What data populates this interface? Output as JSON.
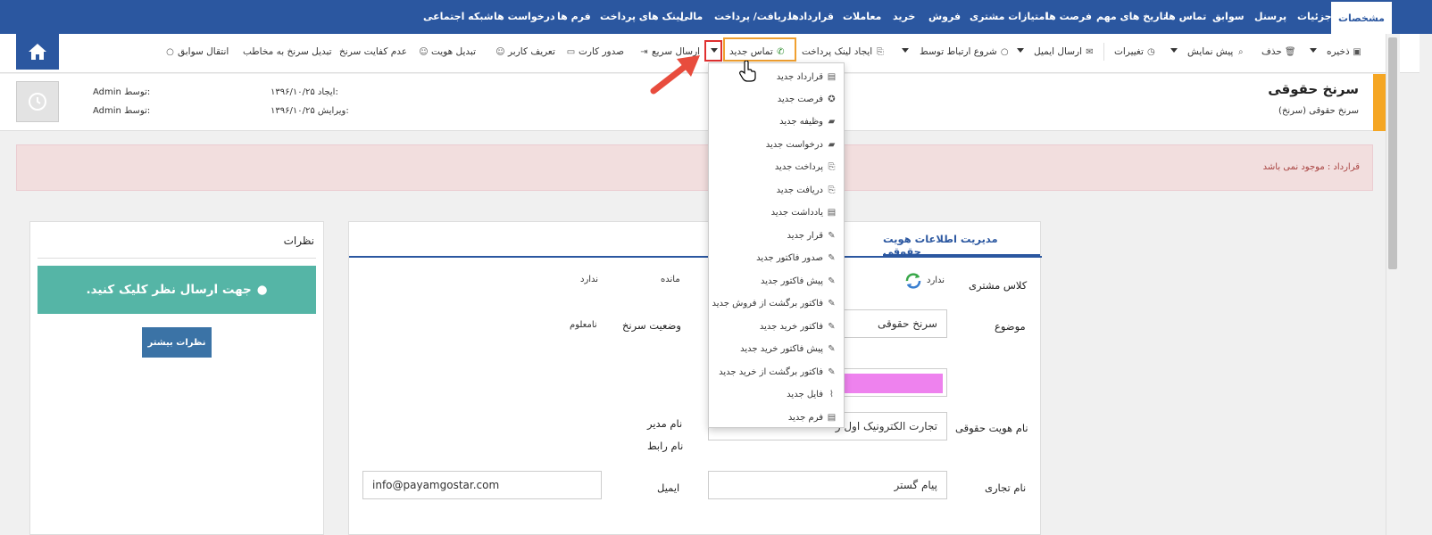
{
  "topnav": {
    "tabs": [
      {
        "label": "مشخصات",
        "active": true
      },
      {
        "label": "جزئیات"
      },
      {
        "label": "پرسنل"
      },
      {
        "label": "سوابق"
      },
      {
        "label": "تماس ها"
      },
      {
        "label": "تاریخ های مهم"
      },
      {
        "label": "فرصت ها"
      },
      {
        "label": "امتیازات مشتری"
      },
      {
        "label": "فروش"
      },
      {
        "label": "خرید"
      },
      {
        "label": "معاملات"
      },
      {
        "label": "قراردادها"
      },
      {
        "label": "دریافت/ پرداخت"
      },
      {
        "label": "مالی"
      },
      {
        "label": "لینک های پرداخت"
      },
      {
        "label": "فرم ها"
      },
      {
        "label": "درخواست ها"
      },
      {
        "label": "شبکه اجتماعی"
      }
    ]
  },
  "toolbar": {
    "save": "ذخیره",
    "delete": "حذف",
    "preview": "پیش نمایش",
    "changes": "تغییرات",
    "send_email": "ارسال ایمیل",
    "start_contact": "شروع ارتباط توسط",
    "create_payment_link": "ایجاد لینک پرداخت",
    "new_call": "تماس جدید",
    "quick_send": "ارسال سریع",
    "issue_card": "صدور کارت",
    "define_user": "تعریف کاربر",
    "change_identity": "تبدیل هویت",
    "lead_disqualify": "عدم کفایت سرنخ",
    "convert_to_contact": "تبدیل سرنخ به مخاطب",
    "transfer_history": "انتقال سوابق"
  },
  "record": {
    "title": "سرنخ حقوقی",
    "subtitle": "سرنخ حقوقی (سرنخ)",
    "created_label": "ایجاد:",
    "created_date": "۱۳۹۶/۱۰/۲۵",
    "edited_label": "ویرایش:",
    "edited_date": "۱۳۹۶/۱۰/۲۵",
    "by_label": "توسط:",
    "created_by": "Admin",
    "edited_by": "Admin"
  },
  "alert": {
    "text": "قرارداد : موجود نمی باشد"
  },
  "panel": {
    "tab_title": "مدیریت اطلاعات هویت حقوقی",
    "customer_class_label": "کلاس مشتری",
    "customer_class_value": "ندارد",
    "balance_label": "مانده",
    "balance_value": "ندارد",
    "subject_label": "موضوع",
    "subject_value": "سرنخ حقوقی",
    "lead_status_label": "وضعیت سرنخ",
    "lead_status_value": "نامعلوم",
    "legal_name_label": "نام هویت حقوقی",
    "legal_name_value": "تجارت الکترونیک اول ر",
    "manager_name_label": "نام مدیر",
    "liaison_name_label": "نام رابط",
    "trade_name_label": "نام تجاری",
    "trade_name_value": "پیام گستر",
    "email_label": "ایمیل",
    "email_value": "info@payamgostar.com"
  },
  "comments": {
    "title": "نظرات",
    "cta": ".جهت ارسال نظر کلیک کنید",
    "more": "نظرات بیشتر"
  },
  "dropdown": {
    "items": [
      {
        "label": "قرارداد جدید",
        "icon": "document-icon"
      },
      {
        "label": "فرصت جدید",
        "icon": "award-icon"
      },
      {
        "label": "وظیفه جدید",
        "icon": "briefcase-icon"
      },
      {
        "label": "درخواست جدید",
        "icon": "briefcase-icon"
      },
      {
        "label": "پرداخت جدید",
        "icon": "payment-icon"
      },
      {
        "label": "دریافت جدید",
        "icon": "payment-icon"
      },
      {
        "label": "یادداشت جدید",
        "icon": "document-icon"
      },
      {
        "label": "قرار جدید",
        "icon": "edit-document-icon"
      },
      {
        "label": "صدور فاکتور جدید",
        "icon": "edit-document-icon"
      },
      {
        "label": "پیش فاکتور جدید",
        "icon": "edit-document-icon"
      },
      {
        "label": "فاکتور برگشت از فروش جدید",
        "icon": "edit-document-icon"
      },
      {
        "label": "فاکتور خرید جدید",
        "icon": "edit-document-icon"
      },
      {
        "label": "پیش فاکتور خرید جدید",
        "icon": "edit-document-icon"
      },
      {
        "label": "فاکتور برگشت از خرید جدید",
        "icon": "edit-document-icon"
      },
      {
        "label": "فایل جدید",
        "icon": "paperclip-icon"
      },
      {
        "label": "فرم جدید",
        "icon": "document-icon"
      }
    ]
  },
  "colors": {
    "brand_blue": "#2b57a0",
    "accent_orange": "#f5a623",
    "alert_bg": "#f2dede",
    "comment_cta": "#55b5a6",
    "highlight_red": "#e03030",
    "highlight_orange": "#f0a030"
  }
}
